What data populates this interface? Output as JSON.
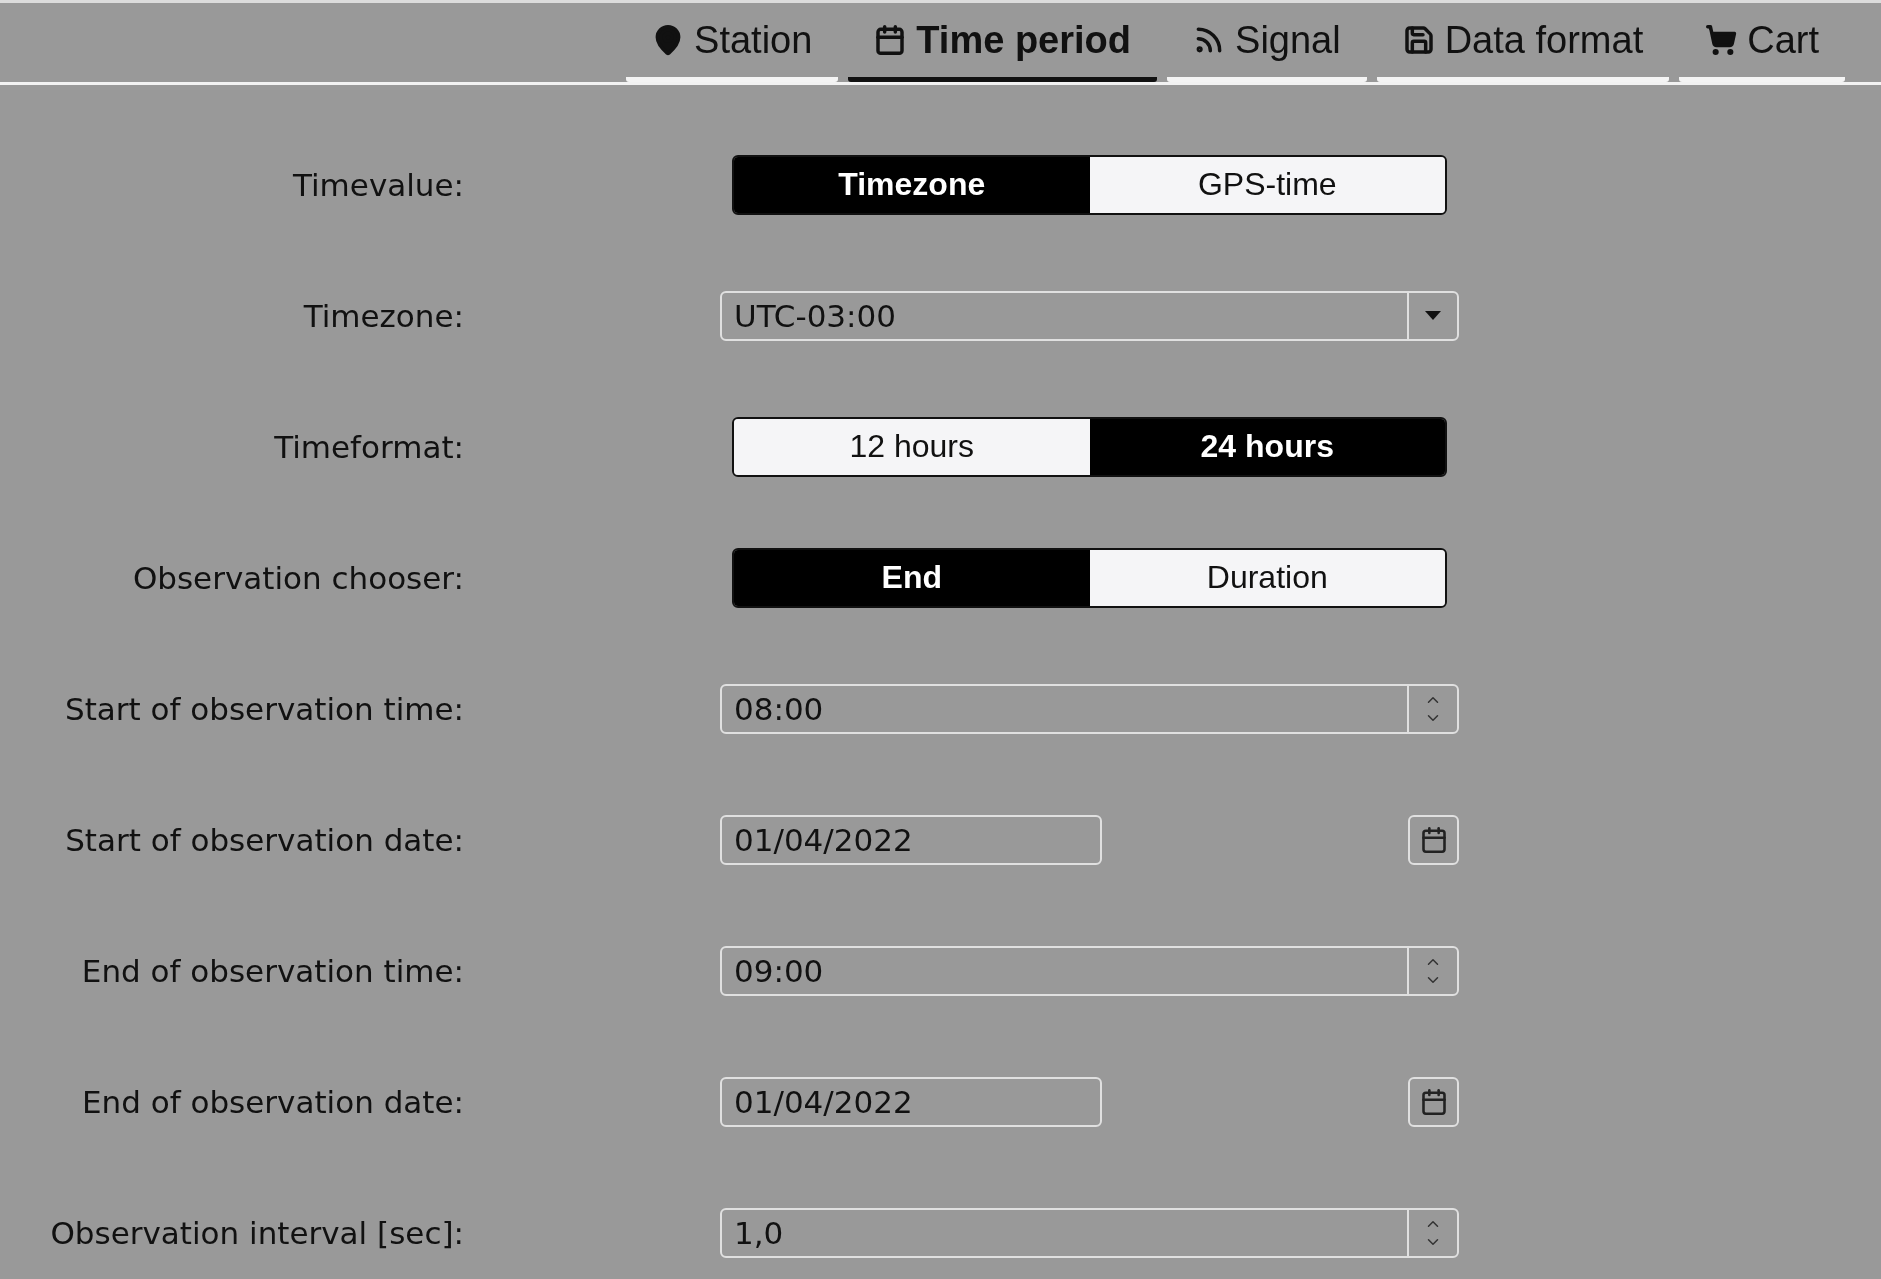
{
  "tabs": [
    {
      "label": "Station",
      "selected": false
    },
    {
      "label": "Time period",
      "selected": true
    },
    {
      "label": "Signal",
      "selected": false
    },
    {
      "label": "Data format",
      "selected": false
    },
    {
      "label": "Cart",
      "selected": false
    }
  ],
  "form": [
    {
      "kind": "segmented",
      "label": "Timevalue:",
      "options": [
        {
          "label": "Timezone",
          "selected": true
        },
        {
          "label": "GPS-time",
          "selected": false
        }
      ]
    },
    {
      "kind": "select",
      "label": "Timezone:",
      "value": "UTC-03:00"
    },
    {
      "kind": "segmented",
      "label": "Timeformat:",
      "options": [
        {
          "label": "12 hours",
          "selected": false
        },
        {
          "label": "24 hours",
          "selected": true
        }
      ]
    },
    {
      "kind": "segmented",
      "label": "Observation chooser:",
      "options": [
        {
          "label": "End",
          "selected": true
        },
        {
          "label": "Duration",
          "selected": false
        }
      ]
    },
    {
      "kind": "spinner",
      "label": "Start of observation time:",
      "value": "08:00"
    },
    {
      "kind": "date",
      "label": "Start of observation date:",
      "value": "01/04/2022"
    },
    {
      "kind": "spinner",
      "label": "End of observation time:",
      "value": "09:00"
    },
    {
      "kind": "date",
      "label": "End of observation date:",
      "value": "01/04/2022"
    },
    {
      "kind": "spinner",
      "label": "Observation interval [sec]:",
      "value": "1,0"
    }
  ]
}
